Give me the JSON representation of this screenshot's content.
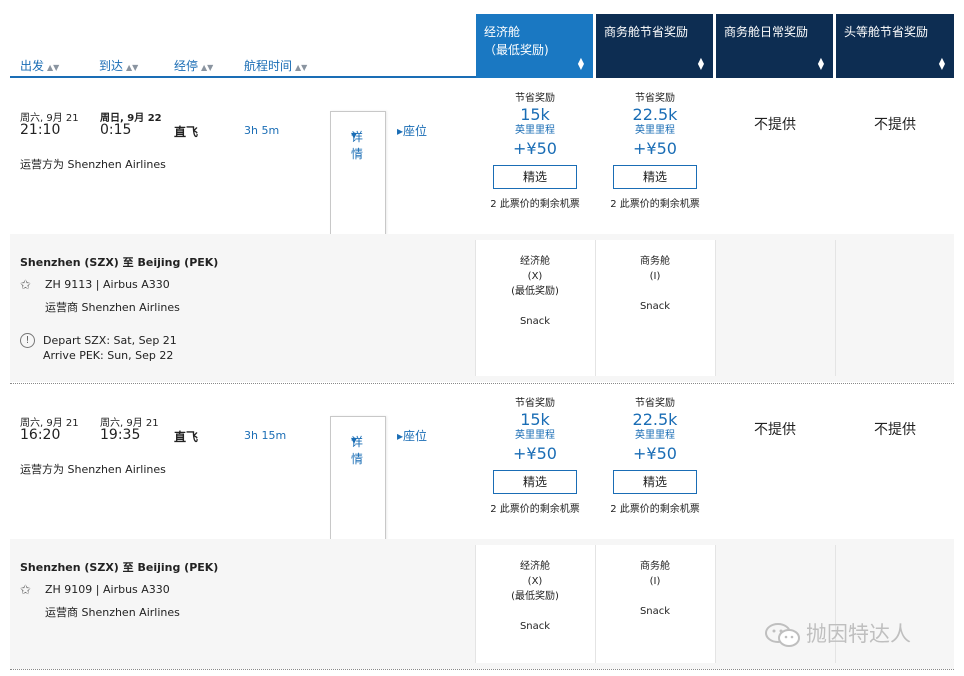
{
  "header": {
    "sort_columns": [
      "出发",
      "到达",
      "经停",
      "航程时间"
    ],
    "cabins": [
      {
        "line1": "经济舱",
        "line2": "（最低奖励)",
        "selected": true
      },
      {
        "line1": "商务舱节省奖励",
        "line2": "",
        "selected": false
      },
      {
        "line1": "商务舱日常奖励",
        "line2": "",
        "selected": false
      },
      {
        "line1": "头等舱节省奖励",
        "line2": "",
        "selected": false
      }
    ],
    "sort_icon": "sort-arrows-icon"
  },
  "flights": [
    {
      "depart_date": "周六, 9月 21",
      "arrive_date": "周日, 9月 22",
      "depart_time": "21:10",
      "arrive_time": "0:15",
      "stops": "直飞",
      "duration": "3h 5m",
      "operated_by": "运营方为 Shenzhen Airlines",
      "details_link": "详情",
      "seats_link": "座位",
      "fares": [
        {
          "label": "节省奖励",
          "miles": "15k",
          "unit": "英里里程",
          "tax": "+¥50",
          "button": "精选",
          "seats": "2 此票价的剩余机票"
        },
        {
          "label": "节省奖励",
          "miles": "22.5k",
          "unit": "英里里程",
          "tax": "+¥50",
          "button": "精选",
          "seats": "2 此票价的剩余机票"
        }
      ],
      "unavailable": [
        "不提供",
        "不提供"
      ],
      "detail": {
        "route": "Shenzhen (SZX) 至 Beijing (PEK)",
        "flight": "ZH 9113 | Airbus A330",
        "operator": "运营商 Shenzhen Airlines",
        "notice": [
          "Depart SZX: Sat, Sep 21",
          "Arrive PEK: Sun, Sep 22"
        ],
        "cabins": [
          {
            "name": "经济舱",
            "code": "(X)",
            "note": "(最低奖励)",
            "meal": "Snack"
          },
          {
            "name": "商务舱",
            "code": "(I)",
            "note": "",
            "meal": "Snack"
          }
        ]
      }
    },
    {
      "depart_date": "周六, 9月 21",
      "arrive_date": "周六, 9月 21",
      "depart_time": "16:20",
      "arrive_time": "19:35",
      "stops": "直飞",
      "duration": "3h 15m",
      "operated_by": "运营方为 Shenzhen Airlines",
      "details_link": "详情",
      "seats_link": "座位",
      "fares": [
        {
          "label": "节省奖励",
          "miles": "15k",
          "unit": "英里里程",
          "tax": "+¥50",
          "button": "精选",
          "seats": "2 此票价的剩余机票"
        },
        {
          "label": "节省奖励",
          "miles": "22.5k",
          "unit": "英里里程",
          "tax": "+¥50",
          "button": "精选",
          "seats": "2 此票价的剩余机票"
        }
      ],
      "unavailable": [
        "不提供",
        "不提供"
      ],
      "detail": {
        "route": "Shenzhen (SZX) 至 Beijing (PEK)",
        "flight": "ZH 9109 | Airbus A330",
        "operator": "运营商 Shenzhen Airlines",
        "cabins": [
          {
            "name": "经济舱",
            "code": "(X)",
            "note": "(最低奖励)",
            "meal": "Snack"
          },
          {
            "name": "商务舱",
            "code": "(I)",
            "note": "",
            "meal": "Snack"
          }
        ]
      }
    }
  ],
  "watermark": "抛因特达人",
  "colors": {
    "accent": "#1a6db5",
    "header_dark": "#0d2d52",
    "header_selected": "#1a78c2"
  }
}
